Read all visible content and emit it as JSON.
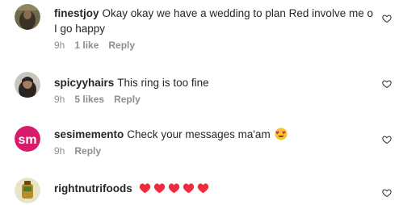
{
  "comments": [
    {
      "username": "finestjoy",
      "text": "Okay okay we have a wedding to plan Red involve me o I go happy",
      "time": "9h",
      "likes": "1 like",
      "reply": "Reply"
    },
    {
      "username": "spicyyhairs",
      "text": "This ring is too fine",
      "time": "9h",
      "likes": "5 likes",
      "reply": "Reply"
    },
    {
      "username": "sesimemento",
      "text": "Check your messages ma'am",
      "time": "9h",
      "reply": "Reply",
      "emoji": "smiling-face-with-heart-eyes-emoji"
    },
    {
      "username": "rightnutrifoods",
      "text": "",
      "emoji": "red-heart-emoji",
      "emoji_count": 5
    }
  ],
  "icons": {
    "like": "heart-outline-icon"
  },
  "colors": {
    "text": "#262626",
    "meta": "#8e8e8e",
    "heart_red": "#ed2d3c",
    "sesi_avatar": "#d81b6a"
  }
}
